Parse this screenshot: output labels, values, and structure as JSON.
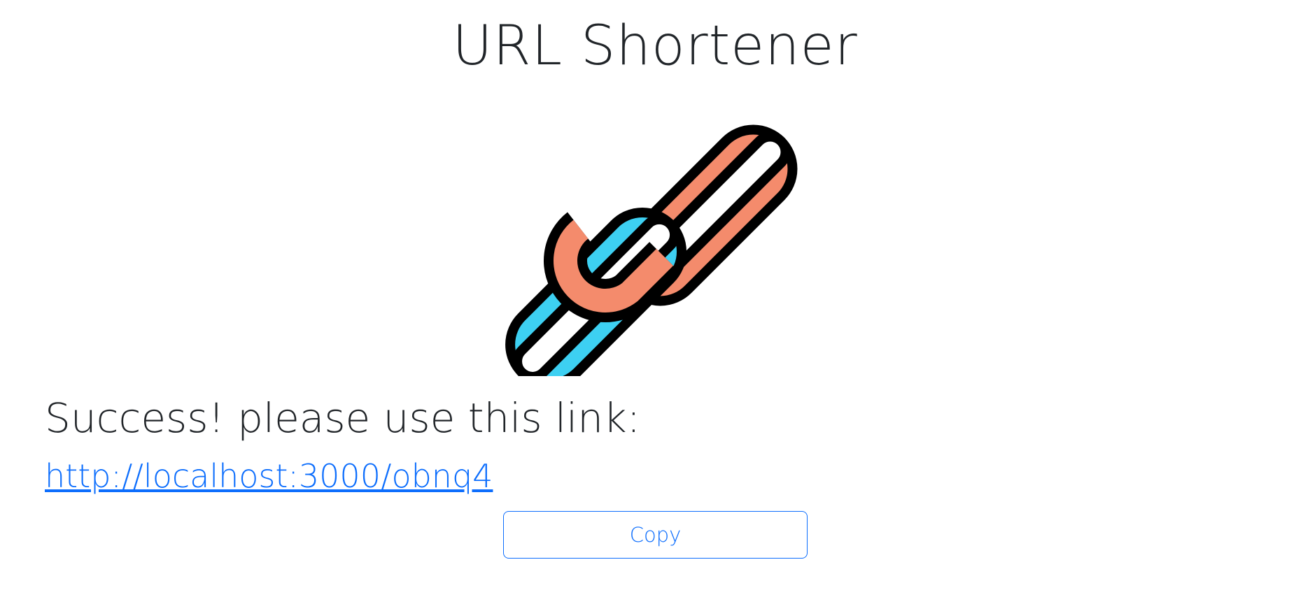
{
  "header": {
    "title": "URL Shortener"
  },
  "logo": {
    "icon": "chain-link-icon",
    "colors": {
      "link_front": "#3dd0f2",
      "link_back": "#f48b6c",
      "outline": "#000000"
    }
  },
  "result": {
    "message": "Success! please use this link:",
    "short_url": "http://localhost:3000/obnq4",
    "copy_label": "Copy"
  },
  "theme": {
    "accent": "#0d6efd",
    "text": "#212529",
    "background": "#ffffff"
  }
}
